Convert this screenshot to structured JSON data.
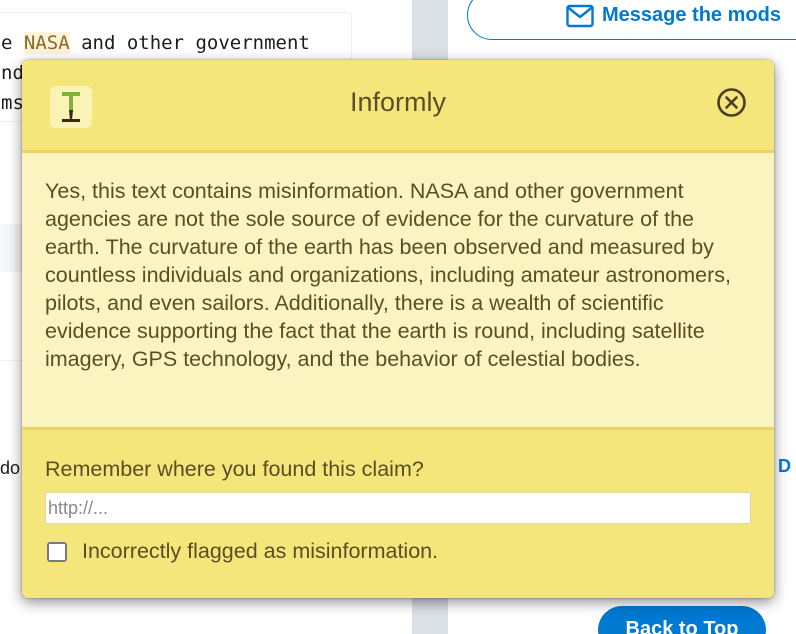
{
  "background": {
    "code_lines": [
      {
        "prefix": "e ",
        "highlight": "NASA",
        "suffix": " and other government"
      },
      {
        "prefix": "nd",
        "highlight": "",
        "suffix": ""
      },
      {
        "prefix": "ms",
        "highlight": "",
        "suffix": ""
      }
    ],
    "fragment_do": "do",
    "fragment_right": "D",
    "message_mods_label": "Message the mods",
    "back_to_top_label": "Back to Top",
    "accent_color": "#0079d3"
  },
  "popup": {
    "title": "Informly",
    "logo_icon": "informly-logo-icon",
    "close_icon": "close-circle-icon",
    "verdict_text": "Yes, this text contains misinformation. NASA and other government agencies are not the sole source of evidence for the curvature of the earth. The curvature of the earth has been observed and measured by countless individuals and organizations, including amateur astronomers, pilots, and even sailors. Additionally, there is a wealth of scientific evidence supporting the fact that the earth is round, including satellite imagery, GPS technology, and the behavior of celestial bodies.",
    "source_label": "Remember where you found this claim?",
    "source_value": "",
    "source_placeholder": "http://...",
    "flag_label": "Incorrectly flagged as misinformation.",
    "flag_checked": false,
    "colors": {
      "header": "#f5e67b",
      "body": "#fbf4c0",
      "text": "#5b4e24"
    }
  }
}
